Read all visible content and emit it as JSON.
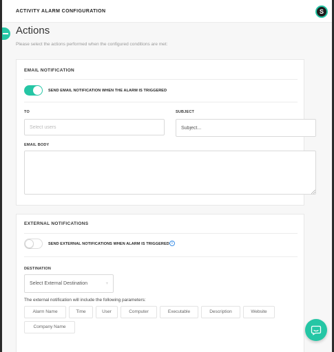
{
  "header": {
    "title": "ACTIVITY ALARM CONFIGURATION",
    "avatar_initial": "S"
  },
  "page": {
    "title": "Actions",
    "subtitle": "Please select the actions performed when the configured conditions are met:"
  },
  "email_notification": {
    "section_title": "EMAIL NOTIFICATION",
    "toggle_label": "SEND EMAIL NOTIFICATION WHEN THE ALARM IS TRIGGERED",
    "toggle_on": true,
    "to_label": "TO",
    "to_placeholder": "Select users",
    "subject_label": "SUBJECT",
    "subject_placeholder": "Subject...",
    "body_label": "EMAIL BODY"
  },
  "external_notifications": {
    "section_title": "EXTERNAL NOTIFICATIONS",
    "toggle_label": "SEND EXTERNAL NOTIFICATIONS WHEN ALARM IS TRIGGERED",
    "toggle_on": false,
    "info_glyph": "i",
    "destination_label": "DESTINATION",
    "destination_value": "Select External Destination",
    "destination_caret": "+",
    "params_intro": "The external notification will include the following parameters:",
    "params": [
      "Alarm Name",
      "Time",
      "User",
      "Computer",
      "Executable",
      "Description",
      "Website",
      "Company Name"
    ]
  },
  "colors": {
    "accent": "#25c6a5",
    "info": "#3a8ee6"
  }
}
